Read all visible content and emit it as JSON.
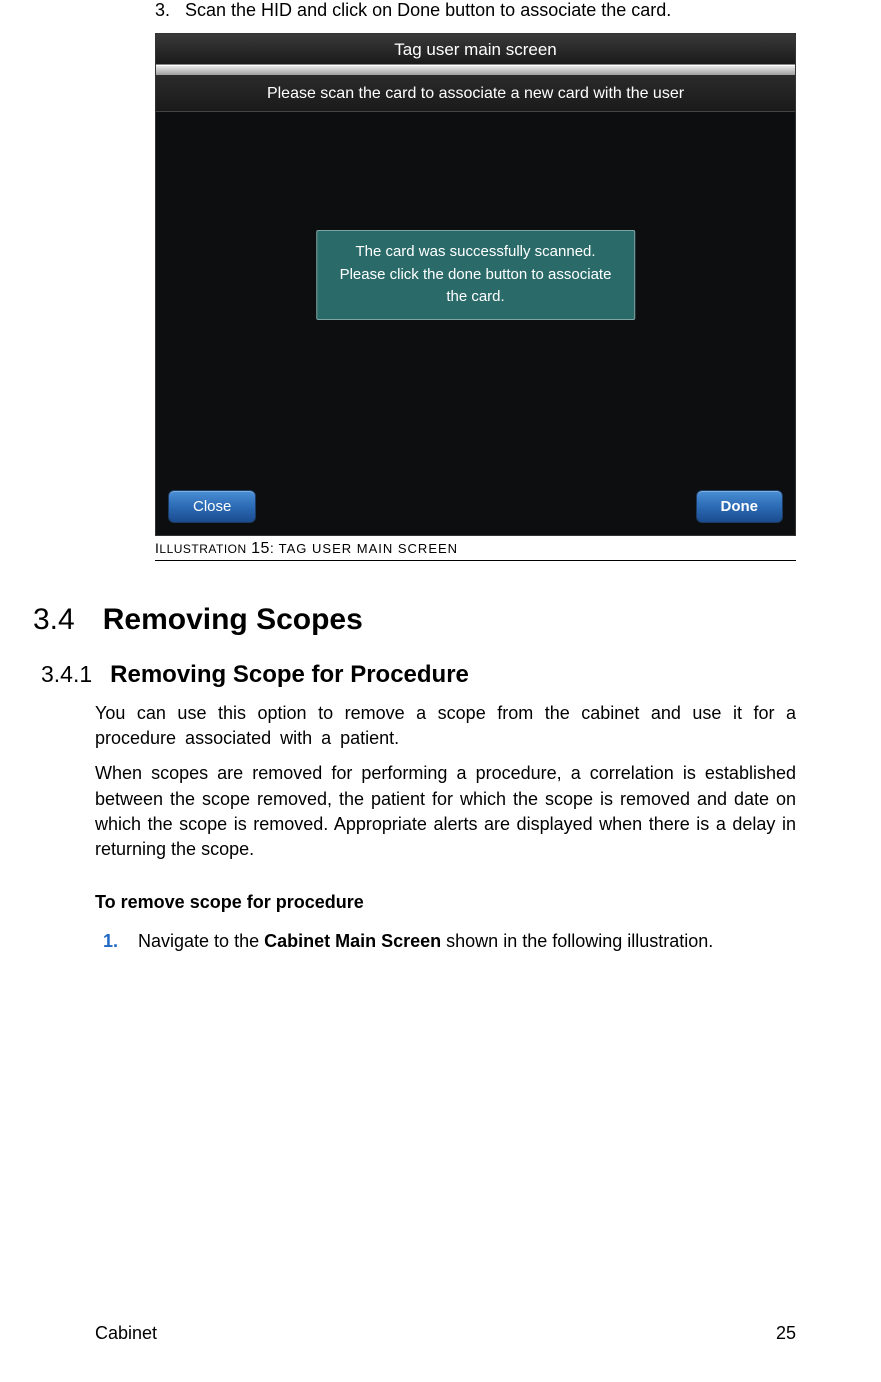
{
  "step3": {
    "number": "3.",
    "text": "Scan the HID and click on Done button to associate the card."
  },
  "screenshot": {
    "title": "Tag user main screen",
    "instruction": "Please scan the card to associate a new card with the user",
    "modal": {
      "line1": "The card was successfully scanned.",
      "line2": "Please click the done button to associate the card."
    },
    "close_label": "Close",
    "done_label": "Done"
  },
  "caption": {
    "prefix": "I",
    "word": "LLUSTRATION",
    "number": "15",
    "colon": ":",
    "rest": "TAG  USER MAIN   SCREEN"
  },
  "section": {
    "number": "3.4",
    "title": "Removing Scopes"
  },
  "subsection": {
    "number": "3.4.1",
    "title": "Removing Scope for Procedure"
  },
  "para1": "You can use this option to remove a scope from the cabinet and use it for a procedure associated with a patient.",
  "para2": "When scopes are removed for performing a procedure, a correlation is established between the scope removed, the patient for which the scope is removed and date on which the scope is removed. Appropriate alerts are displayed when there is a delay in returning the scope.",
  "remove_heading": "To remove scope for procedure",
  "step1": {
    "number": "1.",
    "pre": "Navigate to the ",
    "bold": "Cabinet Main Screen",
    "post": " shown in the following illustration."
  },
  "footer": {
    "left": "Cabinet",
    "right": "25"
  }
}
